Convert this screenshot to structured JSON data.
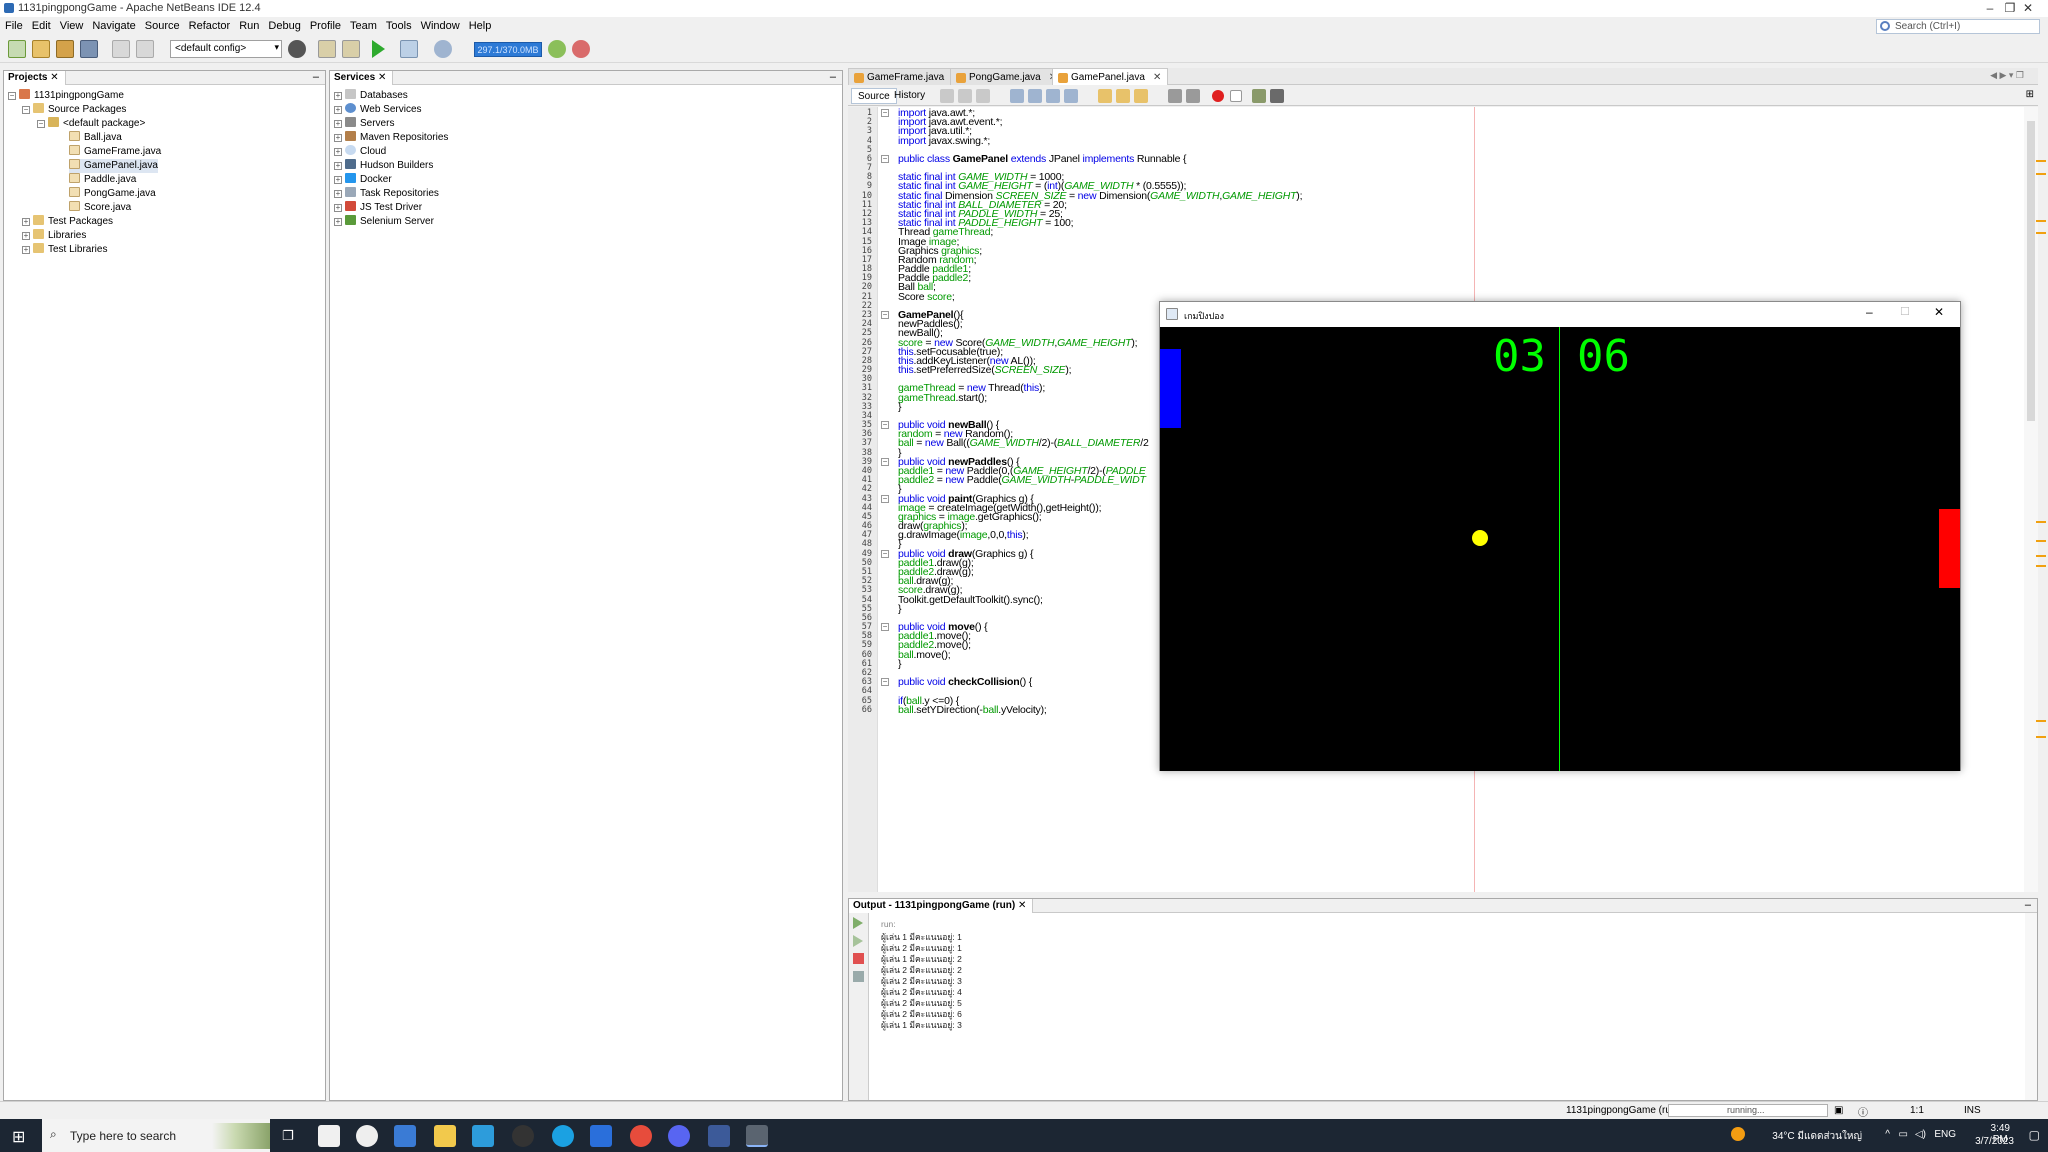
{
  "window": {
    "title": "1131pingpongGame - Apache NetBeans IDE 12.4",
    "minimize": "–",
    "maximize": "❐",
    "close": "✕"
  },
  "menu": [
    "File",
    "Edit",
    "View",
    "Navigate",
    "Source",
    "Refactor",
    "Run",
    "Debug",
    "Profile",
    "Team",
    "Tools",
    "Window",
    "Help"
  ],
  "search": {
    "placeholder": "Search (Ctrl+I)"
  },
  "toolbar": {
    "config": "<default config>",
    "memory": "297.1/370.0MB"
  },
  "projects": {
    "tab": "Projects",
    "items": [
      {
        "label": "1131pingpongGame",
        "icon": "project-icon",
        "indent": 0
      },
      {
        "label": "Source Packages",
        "icon": "folder-icon",
        "indent": 1
      },
      {
        "label": "<default package>",
        "icon": "package-icon",
        "indent": 2
      },
      {
        "label": "Ball.java",
        "icon": "java-file-icon",
        "indent": 3
      },
      {
        "label": "GameFrame.java",
        "icon": "java-file-icon",
        "indent": 3
      },
      {
        "label": "GamePanel.java",
        "icon": "java-file-icon",
        "indent": 3
      },
      {
        "label": "Paddle.java",
        "icon": "java-file-icon",
        "indent": 3
      },
      {
        "label": "PongGame.java",
        "icon": "java-file-icon",
        "indent": 3
      },
      {
        "label": "Score.java",
        "icon": "java-file-icon",
        "indent": 3
      },
      {
        "label": "Test Packages",
        "icon": "folder-icon",
        "indent": 1
      },
      {
        "label": "Libraries",
        "icon": "folder-icon",
        "indent": 1
      },
      {
        "label": "Test Libraries",
        "icon": "folder-icon",
        "indent": 1
      }
    ]
  },
  "services": {
    "tab": "Services",
    "items": [
      "Databases",
      "Web Services",
      "Servers",
      "Maven Repositories",
      "Cloud",
      "Hudson Builders",
      "Docker",
      "Task Repositories",
      "JS Test Driver",
      "Selenium Server"
    ]
  },
  "editor": {
    "tabs": [
      "GameFrame.java",
      "PongGame.java",
      "GamePanel.java"
    ],
    "active_tab": "GamePanel.java",
    "source_tab": "Source",
    "history_tab": "History",
    "lines": [
      "import java.awt.*;",
      "import java.awt.event.*;",
      "import java.util.*;",
      "import javax.swing.*;",
      "",
      "public class GamePanel extends JPanel implements Runnable {",
      "",
      "static final int GAME_WIDTH = 1000;",
      "static final int GAME_HEIGHT = (int)(GAME_WIDTH * (0.5555));",
      "static final Dimension SCREEN_SIZE = new Dimension(GAME_WIDTH,GAME_HEIGHT);",
      "static final int BALL_DIAMETER = 20;",
      "static final int PADDLE_WIDTH = 25;",
      "static final int PADDLE_HEIGHT = 100;",
      "Thread gameThread;",
      "Image image;",
      "Graphics graphics;",
      "Random random;",
      "Paddle paddle1;",
      "Paddle paddle2;",
      "Ball ball;",
      "Score score;",
      "",
      "GamePanel(){",
      "newPaddles();",
      "newBall();",
      "score = new Score(GAME_WIDTH,GAME_HEIGHT);",
      "this.setFocusable(true);",
      "this.addKeyListener(new AL());",
      "this.setPreferredSize(SCREEN_SIZE);",
      "",
      "gameThread = new Thread(this);",
      "gameThread.start();",
      "}",
      "",
      "public void newBall() {",
      "random = new Random();",
      "ball = new Ball((GAME_WIDTH/2)-(BALL_DIAMETER/2",
      "}",
      "public void newPaddles() {",
      "paddle1 = new Paddle(0,(GAME_HEIGHT/2)-(PADDLE",
      "paddle2 = new Paddle(GAME_WIDTH-PADDLE_WIDT",
      "}",
      "public void paint(Graphics g) {",
      "image = createImage(getWidth(),getHeight());",
      "graphics = image.getGraphics();",
      "draw(graphics);",
      "g.drawImage(image,0,0,this);",
      "}",
      "public void draw(Graphics g) {",
      "paddle1.draw(g);",
      "paddle2.draw(g);",
      "ball.draw(g);",
      "score.draw(g);",
      "Toolkit.getDefaultToolkit().sync();",
      "}",
      "",
      "public void move() {",
      "paddle1.move();",
      "paddle2.move();",
      "ball.move();",
      "}",
      "",
      "public void checkCollision() {",
      "",
      "if(ball.y <=0) {",
      "ball.setYDirection(-ball.yVelocity);"
    ]
  },
  "output": {
    "tab": "Output - 1131pingpongGame (run)",
    "lines": [
      "run:",
      "ผู้เล่น 1 มีคะแนนอยู่: 1",
      "ผู้เล่น 2 มีคะแนนอยู่: 1",
      "ผู้เล่น 1 มีคะแนนอยู่: 2",
      "ผู้เล่น 2 มีคะแนนอยู่: 2",
      "ผู้เล่น 2 มีคะแนนอยู่: 3",
      "ผู้เล่น 2 มีคะแนนอยู่: 4",
      "ผู้เล่น 2 มีคะแนนอยู่: 5",
      "ผู้เล่น 2 มีคะแนนอยู่: 6",
      "ผู้เล่น 1 มีคะแนนอยู่: 3"
    ]
  },
  "statusbar": {
    "task": "1131pingpongGame (run)",
    "progress": "running...",
    "position": "1:1",
    "mode": "INS"
  },
  "game": {
    "title": "เกมปิงปอง",
    "score_left": "03",
    "score_right": "06",
    "colors": {
      "paddle1": "#0000ff",
      "paddle2": "#ff0000",
      "ball": "#ffff00",
      "score": "#00ff00",
      "midline": "#00ff00"
    }
  },
  "taskbar": {
    "search_placeholder": "Type here to search",
    "weather": "34°C มีแดดส่วนใหญ่",
    "lang": "ENG",
    "time": "3:49 PM",
    "date": "3/7/2023"
  }
}
